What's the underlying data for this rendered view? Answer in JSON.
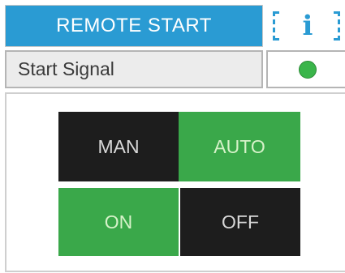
{
  "header": {
    "title": "REMOTE START",
    "info_icon_glyph": "i",
    "info_icon_name": "info-icon"
  },
  "status_row": {
    "label": "Start Signal",
    "indicator_color": "#3ab54a"
  },
  "mode_buttons": {
    "man_label": "MAN",
    "auto_label": "AUTO",
    "active": "AUTO"
  },
  "power_buttons": {
    "on_label": "ON",
    "off_label": "OFF",
    "active": "ON"
  },
  "colors": {
    "accent_blue": "#2a9bd3",
    "active_green": "#3aa84a",
    "inactive_dark": "#1d1d1d"
  }
}
